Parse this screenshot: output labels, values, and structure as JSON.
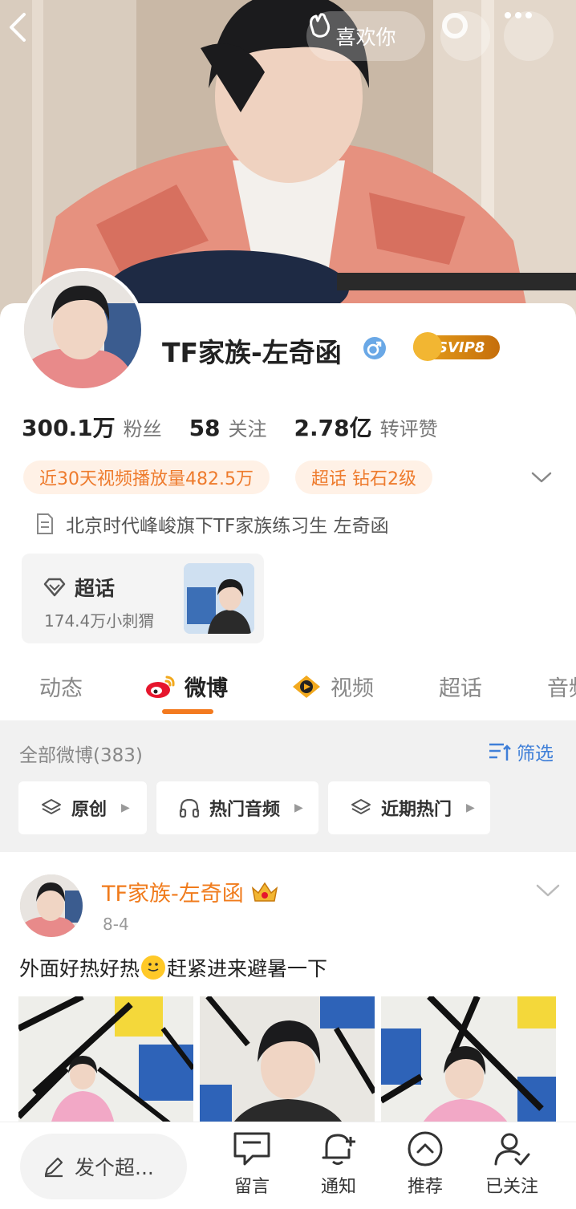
{
  "header": {
    "like_label": "喜欢你",
    "icons": [
      "back-icon",
      "clap-icon",
      "circle-icon",
      "more-icon"
    ]
  },
  "profile": {
    "name": "TF家族-左奇函",
    "vip_badge": "SVIP8",
    "stats": [
      {
        "value": "300.1万",
        "label": "粉丝"
      },
      {
        "value": "58",
        "label": "关注"
      },
      {
        "value": "2.78亿",
        "label": "转评赞"
      }
    ],
    "tags": [
      "近30天视频播放量482.5万",
      "超话 钻石2级"
    ],
    "bio": "北京时代峰峻旗下TF家族练习生 左奇函",
    "chaohua": {
      "title": "超话",
      "subtitle": "174.4万小刺猬"
    }
  },
  "tabs": [
    {
      "label": "动态"
    },
    {
      "label": "微博"
    },
    {
      "label": "视频"
    },
    {
      "label": "超话"
    },
    {
      "label": "音频"
    }
  ],
  "feed": {
    "all_count": "全部微博(383)",
    "filter_label": "筛选",
    "chips": [
      "原创",
      "热门音频",
      "近期热门"
    ]
  },
  "post": {
    "author": "TF家族-左奇函",
    "date": "8-4",
    "text_before": "外面好热好热",
    "text_after": "赶紧进来避暑一下"
  },
  "bottom": {
    "compose_label": "发个超...",
    "nav": [
      {
        "label": "留言"
      },
      {
        "label": "通知"
      },
      {
        "label": "推荐"
      },
      {
        "label": "已关注"
      }
    ]
  },
  "colors": {
    "accent_orange": "#f37a1f",
    "link_blue": "#3f7fd8",
    "tag_bg": "#fff1e6"
  }
}
